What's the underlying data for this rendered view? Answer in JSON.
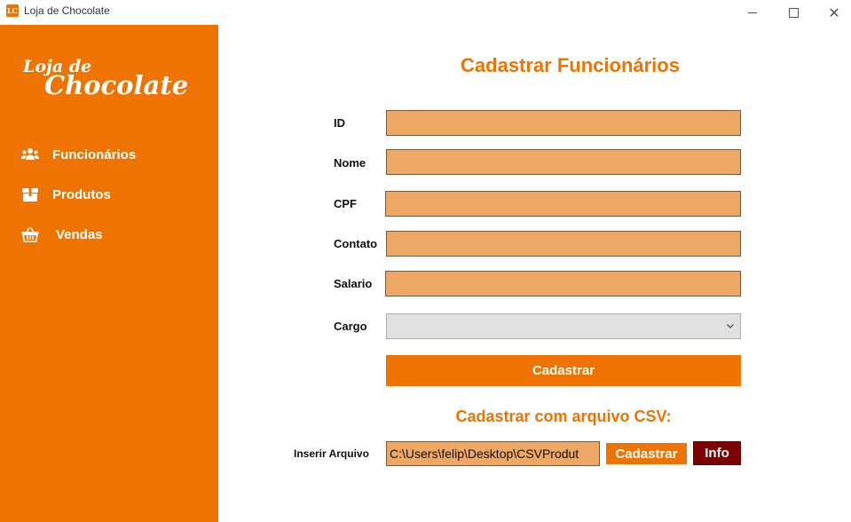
{
  "window": {
    "title": "Loja de Chocolate",
    "icon_text": "LC"
  },
  "sidebar": {
    "logo_line1": "Loja de",
    "logo_line2": "Chocolate",
    "items": [
      {
        "label": "Funcionários",
        "icon": "users-icon"
      },
      {
        "label": "Produtos",
        "icon": "box-icon"
      },
      {
        "label": "Vendas",
        "icon": "basket-icon"
      }
    ]
  },
  "form": {
    "title": "Cadastrar Funcionários",
    "fields": [
      {
        "label": "ID",
        "value": ""
      },
      {
        "label": "Nome",
        "value": ""
      },
      {
        "label": "CPF",
        "value": ""
      },
      {
        "label": "Contato",
        "value": ""
      },
      {
        "label": "Salario",
        "value": ""
      }
    ],
    "cargo_label": "Cargo",
    "cargo_value": "",
    "submit_label": "Cadastrar"
  },
  "csv": {
    "title": "Cadastrar com arquivo CSV:",
    "file_label": "Inserir Arquivo",
    "file_path": "C:\\Users\\felip\\Desktop\\CSVProdut",
    "submit_label": "Cadastrar",
    "info_label": "Info"
  },
  "colors": {
    "accent": "#ef7300",
    "input_bg": "#eda866",
    "info_button": "#7c0000"
  }
}
